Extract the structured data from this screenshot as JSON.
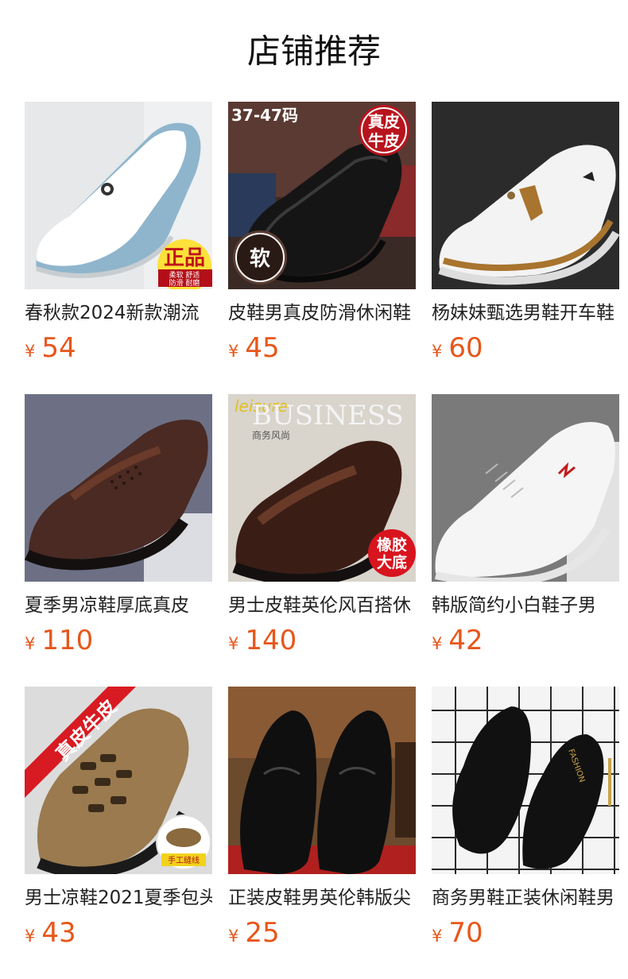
{
  "page": {
    "title": "店铺推荐"
  },
  "currency_symbol": "¥",
  "colors": {
    "price": "#e8561a",
    "title": "#111111"
  },
  "products": [
    {
      "name": "春秋款2024新款潮流",
      "price": "54",
      "badges": [
        "正品",
        "柔软 舒适",
        "防滑 耐磨"
      ]
    },
    {
      "name": "皮鞋男真皮防滑休闲鞋",
      "price": "45",
      "badges": [
        "37-47码",
        "真皮",
        "牛皮",
        "软"
      ]
    },
    {
      "name": "杨妹妹甄选男鞋开车鞋",
      "price": "60",
      "badges": []
    },
    {
      "name": "夏季男凉鞋厚底真皮",
      "price": "110",
      "badges": []
    },
    {
      "name": "男士皮鞋英伦风百搭休",
      "price": "140",
      "badges": [
        "leisure",
        "BUSINESS",
        "商务风尚",
        "橡胶",
        "大底"
      ]
    },
    {
      "name": "韩版简约小白鞋子男",
      "price": "42",
      "badges": []
    },
    {
      "name": "男士凉鞋2021夏季包头",
      "price": "43",
      "badges": [
        "真皮牛皮",
        "手工缝线"
      ]
    },
    {
      "name": "正装皮鞋男英伦韩版尖",
      "price": "25",
      "badges": []
    },
    {
      "name": "商务男鞋正装休闲鞋男",
      "price": "70",
      "badges": [
        "FASHION"
      ]
    }
  ]
}
